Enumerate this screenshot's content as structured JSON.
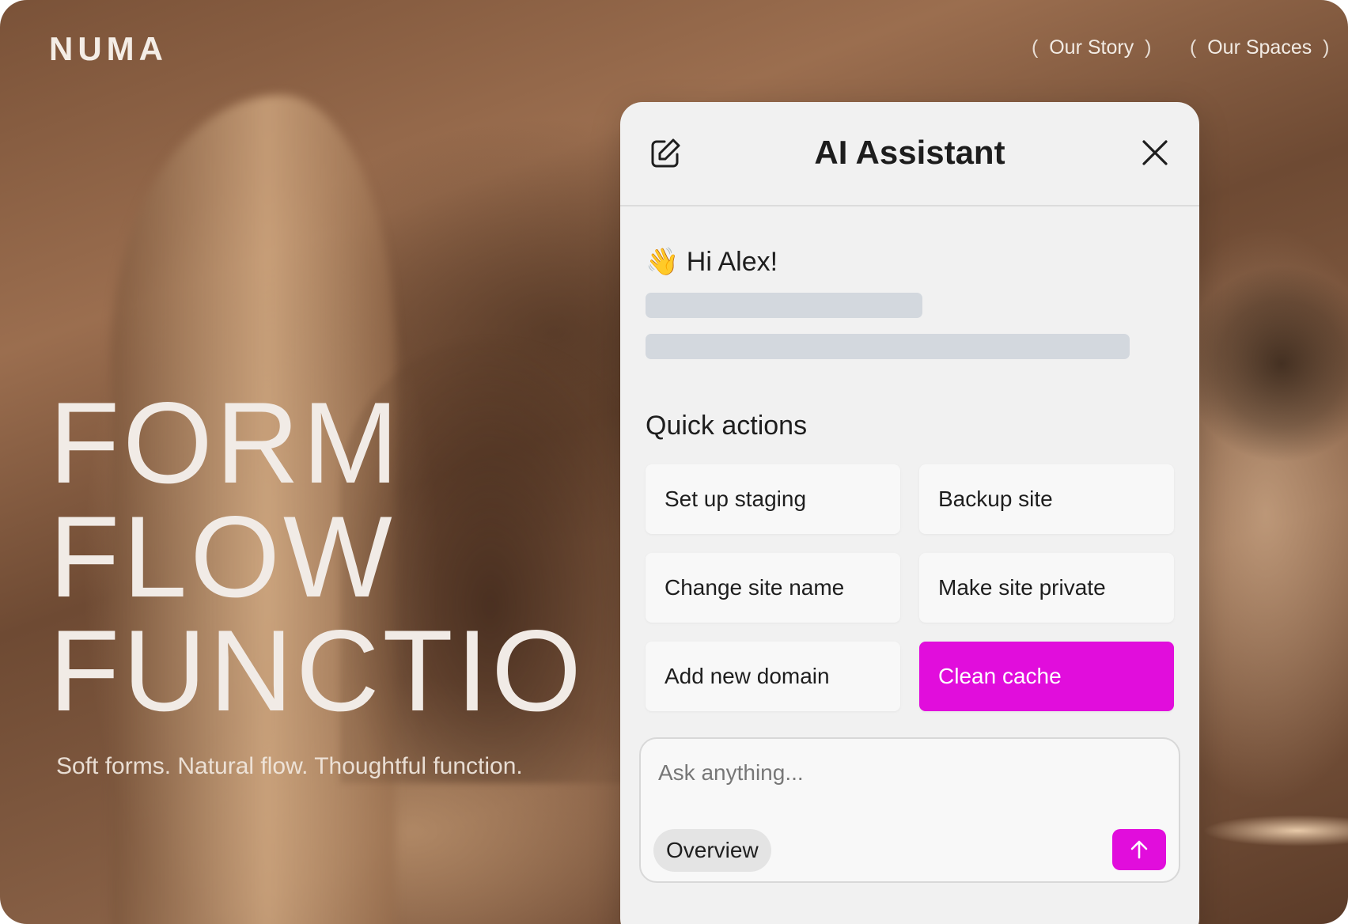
{
  "brand": {
    "logo": "NUMA"
  },
  "nav": {
    "items": [
      {
        "label": "Our Story"
      },
      {
        "label": "Our Spaces"
      }
    ],
    "open_paren": "(",
    "close_paren": ")"
  },
  "hero": {
    "lines": [
      "FORM",
      "FLOW",
      "FUNCTIO"
    ],
    "tagline": "Soft forms. Natural flow. Thoughtful function."
  },
  "assistant": {
    "title": "AI Assistant",
    "greeting_emoji": "👋",
    "greeting": "Hi Alex!",
    "quick_actions_heading": "Quick actions",
    "quick_actions": [
      {
        "label": "Set up staging"
      },
      {
        "label": "Backup site"
      },
      {
        "label": "Change site name"
      },
      {
        "label": "Make site private"
      },
      {
        "label": "Add new domain"
      },
      {
        "label": "Clean cache"
      }
    ],
    "active_action": "Clean cache",
    "composer": {
      "placeholder": "Ask anything...",
      "mode_chip": "Overview"
    },
    "icons": {
      "edit": "edit-icon",
      "close": "close-icon",
      "send": "arrow-up-icon"
    },
    "accent_color": "#e10ddc",
    "skeleton_color": "#d3d8de"
  }
}
